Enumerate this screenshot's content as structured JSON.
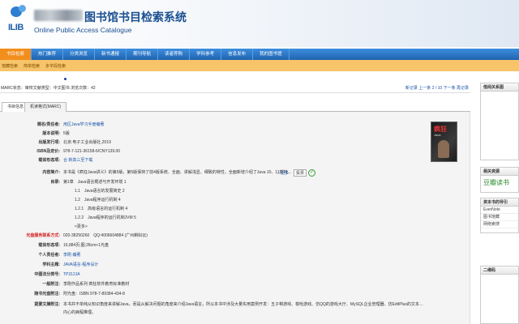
{
  "header": {
    "logo_text": "ILIB",
    "title": "图书馆书目检索系统",
    "subtitle": "Online Public Access Catalogue"
  },
  "nav": [
    "书目检索",
    "热门推荐",
    "分类浏览",
    "新书通报",
    "期刊导航",
    "读者荐购",
    "学科参考",
    "信息发布",
    "我的图书馆"
  ],
  "subnav": [
    "馆藏检索",
    "简单检索",
    "多字段检索"
  ],
  "status": {
    "left": "MARC状态：审校文献类型：中文图书 浏览次数：42",
    "right": "新记录 上一条 2 / 10 下一条 再记录"
  },
  "tabs": [
    "书目信息",
    "机读格式(MARC)"
  ],
  "fields": [
    {
      "label": "题名/责任者:",
      "value": "用区Java学习手册编著"
    },
    {
      "label": "版本说明:",
      "value": "5版"
    },
    {
      "label": "出版发行项:",
      "value": "北京:电子工业出版社,2019"
    },
    {
      "label": "ISBN及定价:",
      "value": "978-7-121-36158-6/CNY139.00"
    },
    {
      "label": "载体形态项:",
      "value": "合 新高三至下载"
    },
    {
      "label": "内容简介:",
      "value": "本书是《疯狂Java讲义》的第5版，第5版保持了前4版系统、全面、讲解浅显、细致的特性，全面新增介绍了Java 10、11新特性..."
    },
    {
      "label": "目录:",
      "value": "第1章　Java语言概述与开发环境 1"
    }
  ],
  "toc": [
    "1.1　Java语言的发展简史 2",
    "1.2　Java程序运行机制 4",
    "1.2.1　高级语言的运行机制 4",
    "1.2.2　Java程序的运行机制JVM 5",
    "<更多>"
  ],
  "fields2": [
    {
      "label": "光盘服务联系方式:",
      "value": "020-38250260　QQ:4006604884 (广州蝌蚪云)",
      "red": true
    },
    {
      "label": "载体形态项:",
      "value": "16,884页;图;28cm+1光盘"
    },
    {
      "label": "个人责任者:",
      "value": "李刚 编著"
    },
    {
      "label": "学科主题:",
      "value": "JAVA语言-程序设计"
    },
    {
      "label": "中图法分类号:",
      "value": "TP312JA"
    },
    {
      "label": "一般附注:",
      "value": "李刚作品系列 疯狂软件教育标准教材"
    },
    {
      "label": "随书光盘附注:",
      "value": "附光盘：ISBN 978-7-89384-434-8"
    },
    {
      "label": "提要文摘附注:",
      "value": "本书并不单纯从知识角度来讲解Java，而是从解决问题的角度来介绍Java语言，所以本书中涉及大量实用案例开发：五子棋游戏、梭哈游戏、仿QQ的游戏大厅、MySQL企业管理器、仿EditPlus的文本编辑器、多线程、断点下载工具、Spring框架的IoC容器......"
    },
    {
      "label": "",
      "value": "内心的病程推理。"
    }
  ],
  "more_link": "...更多",
  "tooltip": "投票",
  "side": {
    "box1": "借阅关系图",
    "box2": "相关资源",
    "douban": "豆瓣读书",
    "box3": "资本书的导引",
    "rows": [
      "EverNote",
      "图书馆藏",
      "网络索搜"
    ],
    "box4": "二维码"
  },
  "cover": {
    "t1": "疯狂",
    "t2": "Java"
  }
}
